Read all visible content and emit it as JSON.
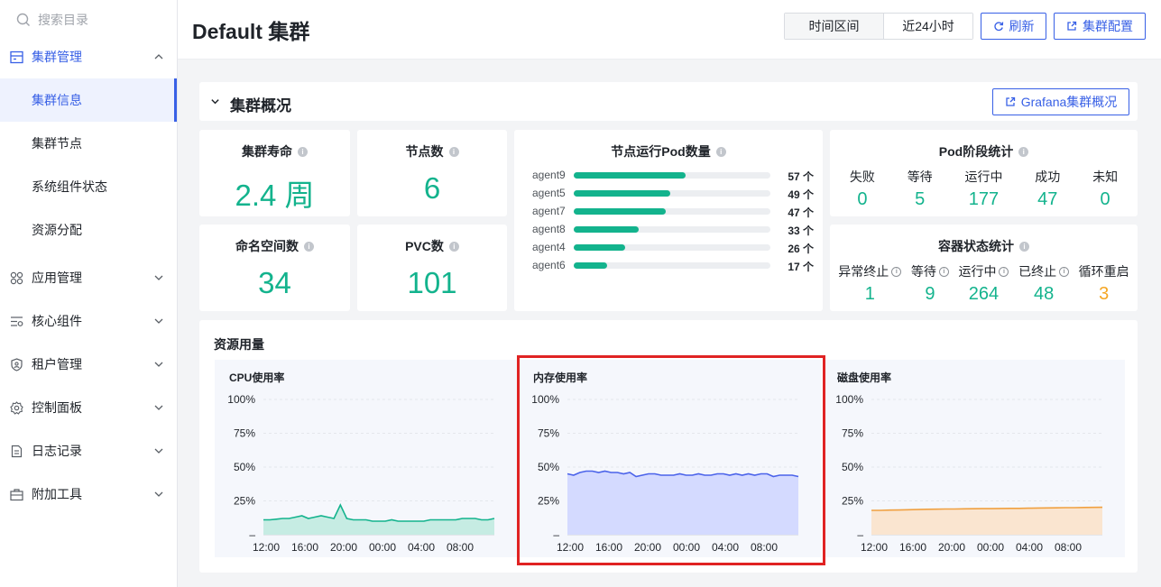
{
  "sidebar": {
    "search_placeholder": "搜索目录",
    "groups": [
      {
        "label": "集群管理",
        "icon": "cluster-icon",
        "expanded": true,
        "children": [
          "集群信息",
          "集群节点",
          "系统组件状态",
          "资源分配"
        ]
      },
      {
        "label": "应用管理",
        "icon": "apps-icon"
      },
      {
        "label": "核心组件",
        "icon": "components-icon"
      },
      {
        "label": "租户管理",
        "icon": "tenant-shield-icon"
      },
      {
        "label": "控制面板",
        "icon": "gear-icon"
      },
      {
        "label": "日志记录",
        "icon": "log-icon"
      },
      {
        "label": "附加工具",
        "icon": "toolbox-icon"
      }
    ]
  },
  "header": {
    "title": "Default 集群",
    "time_label": "时间区间",
    "time_value": "近24小时",
    "refresh_label": "刷新",
    "config_label": "集群配置"
  },
  "overview": {
    "title": "集群概况",
    "grafana_label": "Grafana集群概况",
    "cluster_age": {
      "label": "集群寿命",
      "value": "2.4 周"
    },
    "node_count": {
      "label": "节点数",
      "value": "6"
    },
    "namespace_count": {
      "label": "命名空间数",
      "value": "34"
    },
    "pvc_count": {
      "label": "PVC数",
      "value": "101"
    },
    "node_pods": {
      "label": "节点运行Pod数量",
      "unit": "个",
      "max": 100,
      "rows": [
        {
          "name": "agent9",
          "count": 57,
          "text": "57 个"
        },
        {
          "name": "agent5",
          "count": 49,
          "text": "49 个"
        },
        {
          "name": "agent7",
          "count": 47,
          "text": "47 个"
        },
        {
          "name": "agent8",
          "count": 33,
          "text": "33 个"
        },
        {
          "name": "agent4",
          "count": 26,
          "text": "26 个"
        },
        {
          "name": "agent6",
          "count": 17,
          "text": "17 个"
        }
      ]
    },
    "pod_phase": {
      "label": "Pod阶段统计",
      "items": [
        {
          "label": "失败",
          "value": "0"
        },
        {
          "label": "等待",
          "value": "5"
        },
        {
          "label": "运行中",
          "value": "177"
        },
        {
          "label": "成功",
          "value": "47"
        },
        {
          "label": "未知",
          "value": "0"
        }
      ]
    },
    "container_state": {
      "label": "容器状态统计",
      "items": [
        {
          "label": "异常终止",
          "value": "1",
          "color": "#13b38d"
        },
        {
          "label": "等待",
          "value": "9",
          "color": "#13b38d"
        },
        {
          "label": "运行中",
          "value": "264",
          "color": "#13b38d"
        },
        {
          "label": "已终止",
          "value": "48",
          "color": "#13b38d"
        },
        {
          "label": "循环重启",
          "value": "3",
          "color": "#f5a623"
        }
      ]
    }
  },
  "resource": {
    "title": "资源用量",
    "y_ticks": [
      "100%",
      "75%",
      "50%",
      "25%",
      "–"
    ],
    "x_ticks": [
      "12:00",
      "16:00",
      "20:00",
      "00:00",
      "04:00",
      "08:00"
    ]
  },
  "chart_data": [
    {
      "type": "area",
      "title": "CPU使用率",
      "ylim": [
        0,
        100
      ],
      "color": "#13b38d",
      "fill": "#c6ece3",
      "values": [
        11,
        11,
        11.5,
        12,
        12,
        13,
        14,
        12,
        13,
        14,
        13,
        12,
        22,
        12,
        11,
        11,
        11,
        10,
        10,
        10,
        11,
        10,
        10,
        10,
        10,
        10,
        11,
        11,
        11,
        11,
        11,
        12,
        12,
        12,
        11,
        11,
        12
      ]
    },
    {
      "type": "area",
      "title": "内存使用率",
      "ylim": [
        0,
        100
      ],
      "color": "#4b63ea",
      "fill": "#d4daff",
      "values": [
        45,
        44,
        46,
        47,
        47,
        46,
        47,
        46,
        46,
        45,
        46,
        43,
        44,
        45,
        45,
        44,
        44,
        44,
        45,
        44,
        44,
        45,
        44,
        44,
        45,
        45,
        44,
        45,
        44,
        45,
        44,
        45,
        45,
        43,
        44,
        44,
        44,
        43
      ]
    },
    {
      "type": "area",
      "title": "磁盘使用率",
      "ylim": [
        0,
        100
      ],
      "color": "#f0a040",
      "fill": "#fae5d0",
      "values": [
        18,
        18,
        18.2,
        18.3,
        18.5,
        18.6,
        18.8,
        18.9,
        19,
        19,
        19.1,
        19.2,
        19.3,
        19.3,
        19.4,
        19.5,
        19.5,
        19.6,
        19.7,
        19.8,
        19.9,
        20,
        20,
        20.1,
        20.2,
        20.3
      ]
    }
  ]
}
